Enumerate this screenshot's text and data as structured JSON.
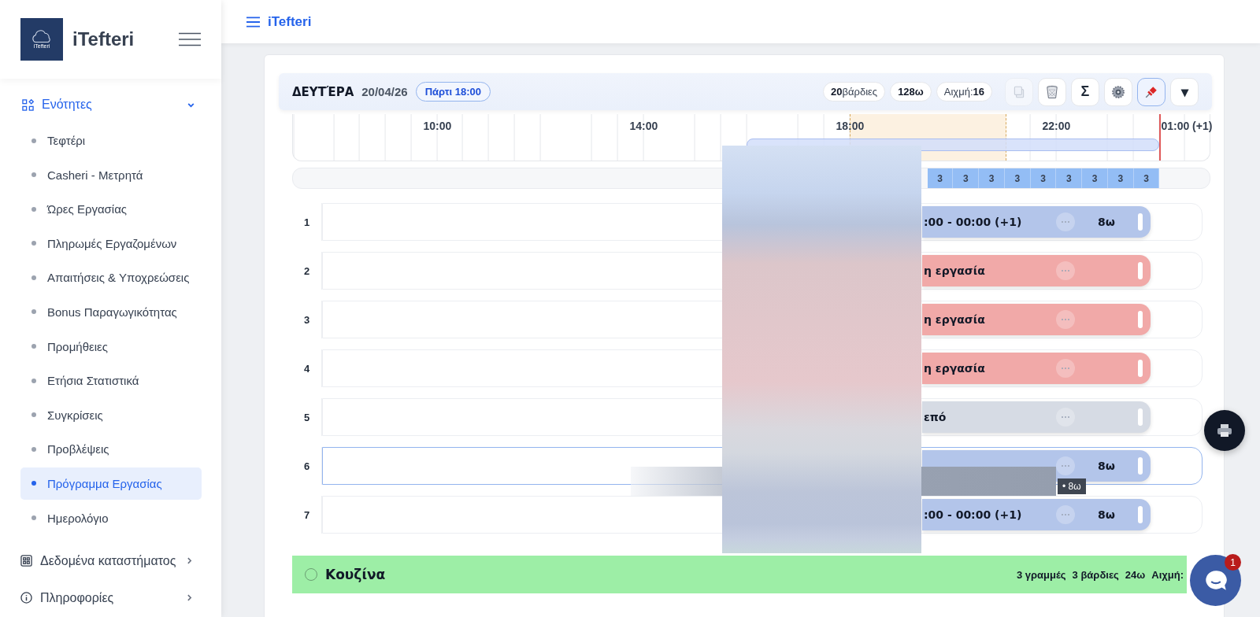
{
  "brand": {
    "logo_text": "iTefteri",
    "name": "iTefteri"
  },
  "topbar": {
    "title": "iTefteri"
  },
  "sidebar": {
    "section": {
      "label": "Ενότητες",
      "expanded": true,
      "items": [
        {
          "label": "Τεφτέρι",
          "selected": false
        },
        {
          "label": "Casheri - Μετρητά",
          "selected": false
        },
        {
          "label": "Ώρες Εργασίας",
          "selected": false
        },
        {
          "label": "Πληρωμές Εργαζομένων",
          "selected": false
        },
        {
          "label": "Απαιτήσεις & Υποχρεώσεις",
          "selected": false
        },
        {
          "label": "Bonus Παραγωγικότητας",
          "selected": false
        },
        {
          "label": "Προμήθειες",
          "selected": false
        },
        {
          "label": "Ετήσια Στατιστικά",
          "selected": false
        },
        {
          "label": "Συγκρίσεις",
          "selected": false
        },
        {
          "label": "Προβλέψεις",
          "selected": false
        },
        {
          "label": "Πρόγραμμα Εργασίας",
          "selected": true
        },
        {
          "label": "Ημερολόγιο",
          "selected": false
        }
      ]
    },
    "groups": [
      {
        "label": "Δεδομένα καταστήματος",
        "kind": "grid"
      },
      {
        "label": "Πληροφορίες",
        "kind": "info"
      }
    ]
  },
  "day": {
    "name": "ΔΕΥΤΈΡΑ",
    "date": "20/04/26",
    "event": "Πάρτι 18:00",
    "stats": [
      {
        "value": "20",
        "unit": "βάρδιες"
      },
      {
        "value": "128ω"
      },
      {
        "label": "Αιχμή:",
        "value": "16"
      }
    ],
    "tools": [
      {
        "kind": "copy",
        "disabled": true,
        "on": false
      },
      {
        "kind": "trash",
        "disabled": false,
        "on": false
      },
      {
        "kind": "text",
        "label": "Σ",
        "disabled": false,
        "on": false
      },
      {
        "kind": "gear",
        "disabled": false,
        "on": false
      },
      {
        "kind": "pin",
        "disabled": false,
        "on": true
      },
      {
        "kind": "text",
        "label": "▾",
        "disabled": false,
        "on": false
      }
    ]
  },
  "timeline": {
    "hours": [
      "10:00",
      "14:00",
      "18:00",
      "22:00",
      "01:00 (+1)"
    ],
    "counts": [
      "3",
      "3",
      "3",
      "3",
      "3",
      "3",
      "3",
      "3",
      "3"
    ]
  },
  "rows": [
    {
      "number": "1",
      "kind": "work",
      "text": ":00 - 00:00 (+1)",
      "hours": "8ω",
      "selected": false
    },
    {
      "number": "2",
      "kind": "leave",
      "text": "η εργασία",
      "selected": false
    },
    {
      "number": "3",
      "kind": "leave",
      "text": "η εργασία",
      "selected": false
    },
    {
      "number": "4",
      "kind": "leave",
      "text": "η εργασία",
      "selected": false
    },
    {
      "number": "5",
      "kind": "off",
      "text": "επό",
      "selected": false
    },
    {
      "number": "6",
      "kind": "work",
      "hours": "8ω",
      "selected": true,
      "tooltip": "• 8ω"
    },
    {
      "number": "7",
      "kind": "work",
      "text": ":00 - 00:00 (+1)",
      "hours": "8ω",
      "selected": false
    }
  ],
  "section": {
    "name": "Κουζίνα",
    "stats": [
      "3 γραμμές",
      "3 βάρδιες",
      "24ω",
      "Αιχμή:"
    ]
  },
  "chat": {
    "badge": "1"
  }
}
